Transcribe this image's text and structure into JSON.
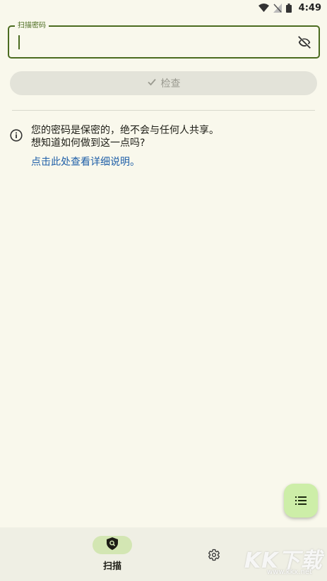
{
  "status_bar": {
    "time": "4:49",
    "icons": [
      "wifi-icon",
      "no-signal-icon",
      "battery-icon"
    ]
  },
  "password_field": {
    "label": "扫描密码",
    "value": "",
    "toggle_icon": "visibility-off-icon"
  },
  "check_button": {
    "label": "检查",
    "icon": "check-icon"
  },
  "info": {
    "icon": "info-icon",
    "line1": "您的密码是保密的，绝不会与任何人共享。",
    "line2": "想知道如何做到这一点吗?",
    "link": "点击此处查看详细说明。"
  },
  "fab": {
    "icon": "list-icon"
  },
  "bottom_nav": {
    "items": [
      {
        "label": "扫描",
        "icon": "shield-search-icon",
        "selected": true
      },
      {
        "label": "",
        "icon": "gear-icon",
        "selected": false
      }
    ]
  },
  "watermark": {
    "text": "KK下载",
    "url": "www.kkx.net"
  },
  "colors": {
    "background": "#f9f8ec",
    "accent": "#4b6b1f",
    "link": "#1f5fa8",
    "fab": "#cdeea8",
    "nav_pill": "#d3e6b3"
  }
}
